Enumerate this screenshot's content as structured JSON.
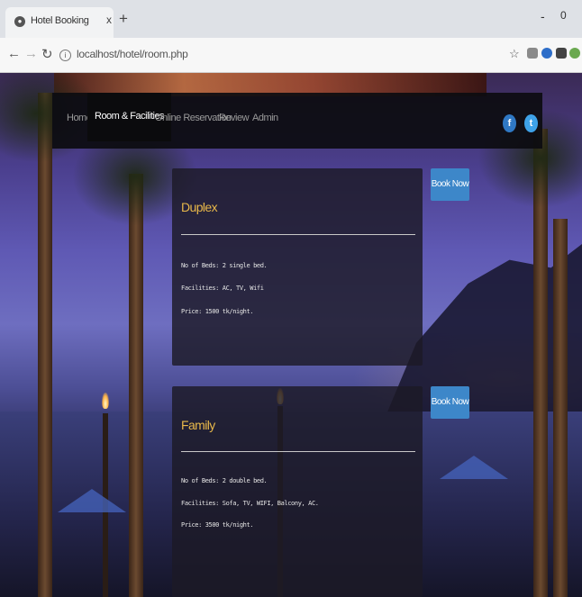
{
  "browser": {
    "tab_title": "Hotel Booking",
    "tab_close": "x",
    "new_tab": "+",
    "url": "localhost/hotel/room.php",
    "window_minimize": "-",
    "window_restore": "0"
  },
  "nav": {
    "items": [
      {
        "label": "Home"
      },
      {
        "label": "Room & Facilities"
      },
      {
        "label": "Online Reservation"
      },
      {
        "label": "Review"
      },
      {
        "label": "Admin"
      }
    ],
    "active_index": 1,
    "social": {
      "facebook": "f",
      "twitter": "t"
    }
  },
  "rooms": [
    {
      "name": "Duplex",
      "beds": "No of Beds: 2 single bed.",
      "facilities": "Facilities: AC, TV, Wifi",
      "price": "Price: 1500 tk/night.",
      "book_label": "Book Now"
    },
    {
      "name": "Family",
      "beds": "No of Beds: 2 double bed.",
      "facilities": "Facilities: Sofa, TV, WIFI, Balcony, AC.",
      "price": "Price: 3500 tk/night.",
      "book_label": "Book Now"
    }
  ],
  "colors": {
    "accent": "#3d87c9",
    "room_title": "#e8b84a",
    "nav_bg": "#0c0c10"
  }
}
